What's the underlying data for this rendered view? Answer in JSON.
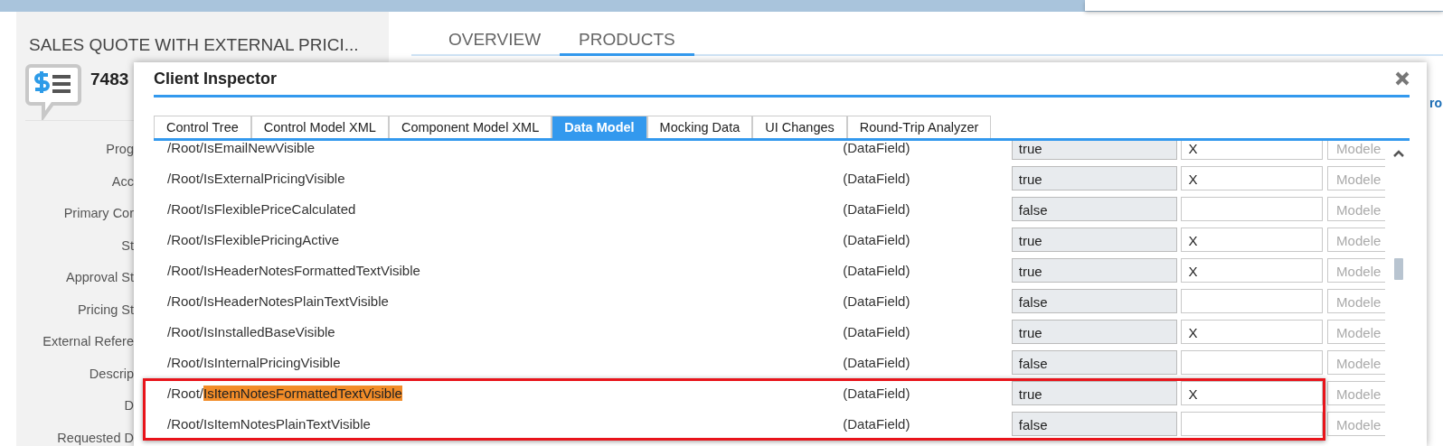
{
  "record": {
    "title": "SALES QUOTE WITH EXTERNAL PRICI...",
    "number": "7483",
    "fields": [
      "Prog",
      "Acc",
      "Primary Cor",
      "St",
      "Approval St",
      "Pricing St",
      "External Refere",
      "Descrip",
      "D",
      "Requested D"
    ]
  },
  "page_tabs": [
    {
      "label": "OVERVIEW",
      "selected": false
    },
    {
      "label": "PRODUCTS",
      "selected": true
    }
  ],
  "side_link": "ro",
  "dialog": {
    "title": "Client Inspector",
    "tabs": [
      {
        "label": "Control Tree",
        "selected": false
      },
      {
        "label": "Control Model XML",
        "selected": false
      },
      {
        "label": "Component Model XML",
        "selected": false
      },
      {
        "label": "Data Model",
        "selected": true
      },
      {
        "label": "Mocking Data",
        "selected": false
      },
      {
        "label": "UI Changes",
        "selected": false
      },
      {
        "label": "Round-Trip Analyzer",
        "selected": false
      }
    ],
    "rows": [
      {
        "path_parent": "/Root/",
        "name": "IsEmailNewVisible",
        "name_highlighted": false,
        "type": "(DataField)",
        "value": "true",
        "flag": "X",
        "placeholder": "Modele",
        "marked": false
      },
      {
        "path_parent": "/Root/",
        "name": "IsExternalPricingVisible",
        "name_highlighted": false,
        "type": "(DataField)",
        "value": "true",
        "flag": "X",
        "placeholder": "Modele",
        "marked": false
      },
      {
        "path_parent": "/Root/",
        "name": "IsFlexiblePriceCalculated",
        "name_highlighted": false,
        "type": "(DataField)",
        "value": "false",
        "placeholder": "Modele",
        "marked": false
      },
      {
        "path_parent": "/Root/",
        "name": "IsFlexiblePricingActive",
        "name_highlighted": false,
        "type": "(DataField)",
        "value": "true",
        "flag": "X",
        "placeholder": "Modele",
        "marked": false
      },
      {
        "path_parent": "/Root/",
        "name": "IsHeaderNotesFormattedTextVisible",
        "name_highlighted": false,
        "type": "(DataField)",
        "value": "true",
        "flag": "X",
        "placeholder": "Modele",
        "marked": false
      },
      {
        "path_parent": "/Root/",
        "name": "IsHeaderNotesPlainTextVisible",
        "name_highlighted": false,
        "type": "(DataField)",
        "value": "false",
        "placeholder": "Modele",
        "marked": false
      },
      {
        "path_parent": "/Root/",
        "name": "IsInstalledBaseVisible",
        "name_highlighted": false,
        "type": "(DataField)",
        "value": "true",
        "flag": "X",
        "placeholder": "Modele",
        "marked": false
      },
      {
        "path_parent": "/Root/",
        "name": "IsInternalPricingVisible",
        "name_highlighted": false,
        "type": "(DataField)",
        "value": "false",
        "placeholder": "Modele",
        "marked": false
      },
      {
        "path_parent": "/Root/",
        "name": "IsItemNotesFormattedTextVisible",
        "name_highlighted": true,
        "type": "(DataField)",
        "value": "true",
        "flag": "X",
        "placeholder": "Modele",
        "marked": true
      },
      {
        "path_parent": "/Root/",
        "name": "IsItemNotesPlainTextVisible",
        "name_highlighted": false,
        "type": "(DataField)",
        "value": "false",
        "placeholder": "Modele",
        "marked": true
      }
    ]
  }
}
